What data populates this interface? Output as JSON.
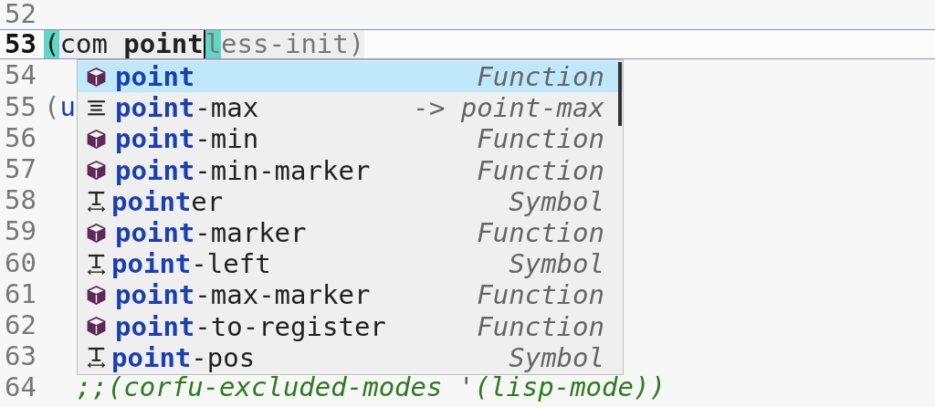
{
  "editor": {
    "lines": [
      {
        "number": "52",
        "current": false
      },
      {
        "number": "53",
        "current": true,
        "segments": [
          {
            "text": "(",
            "kind": "paren-match"
          },
          {
            "text": "com ",
            "kind": "plain"
          },
          {
            "text": "point",
            "kind": "typed"
          },
          {
            "text": "l",
            "kind": "cursor"
          },
          {
            "text": "ess-init)",
            "kind": "preview"
          }
        ]
      },
      {
        "number": "54",
        "current": false
      },
      {
        "number": "55",
        "current": false,
        "segments": [
          {
            "text": "(",
            "kind": "paren"
          },
          {
            "text": "u",
            "kind": "keyword"
          }
        ]
      },
      {
        "number": "56",
        "current": false
      },
      {
        "number": "57",
        "current": false
      },
      {
        "number": "58",
        "current": false
      },
      {
        "number": "59",
        "current": false
      },
      {
        "number": "60",
        "current": false
      },
      {
        "number": "61",
        "current": false
      },
      {
        "number": "62",
        "current": false
      },
      {
        "number": "63",
        "current": false
      },
      {
        "number": "64",
        "current": false,
        "segments": [
          {
            "text": "  ;;(corfu-excluded-modes '(lisp-mode))",
            "kind": "comment"
          }
        ]
      }
    ]
  },
  "completion_popup": {
    "items": [
      {
        "kind": "function",
        "match": "point",
        "annotation": "Function",
        "selected": true
      },
      {
        "kind": "alias",
        "match": "point",
        "rest": "-max",
        "annotation": "-> point-max",
        "selected": false
      },
      {
        "kind": "function",
        "match": "point",
        "rest": "-min",
        "annotation": "Function",
        "selected": false
      },
      {
        "kind": "function",
        "match": "point",
        "rest": "-min-marker",
        "annotation": "Function",
        "selected": false
      },
      {
        "kind": "symbol",
        "match": "point",
        "rest": "er",
        "annotation": "Symbol",
        "selected": false
      },
      {
        "kind": "function",
        "match": "point",
        "rest": "-marker",
        "annotation": "Function",
        "selected": false
      },
      {
        "kind": "symbol",
        "match": "point",
        "rest": "-left",
        "annotation": "Symbol",
        "selected": false
      },
      {
        "kind": "function",
        "match": "point",
        "rest": "-max-marker",
        "annotation": "Function",
        "selected": false
      },
      {
        "kind": "function",
        "match": "point",
        "rest": "-to-register",
        "annotation": "Function",
        "selected": false
      },
      {
        "kind": "symbol",
        "match": "point",
        "rest": "-pos",
        "annotation": "Symbol",
        "selected": false
      }
    ]
  }
}
